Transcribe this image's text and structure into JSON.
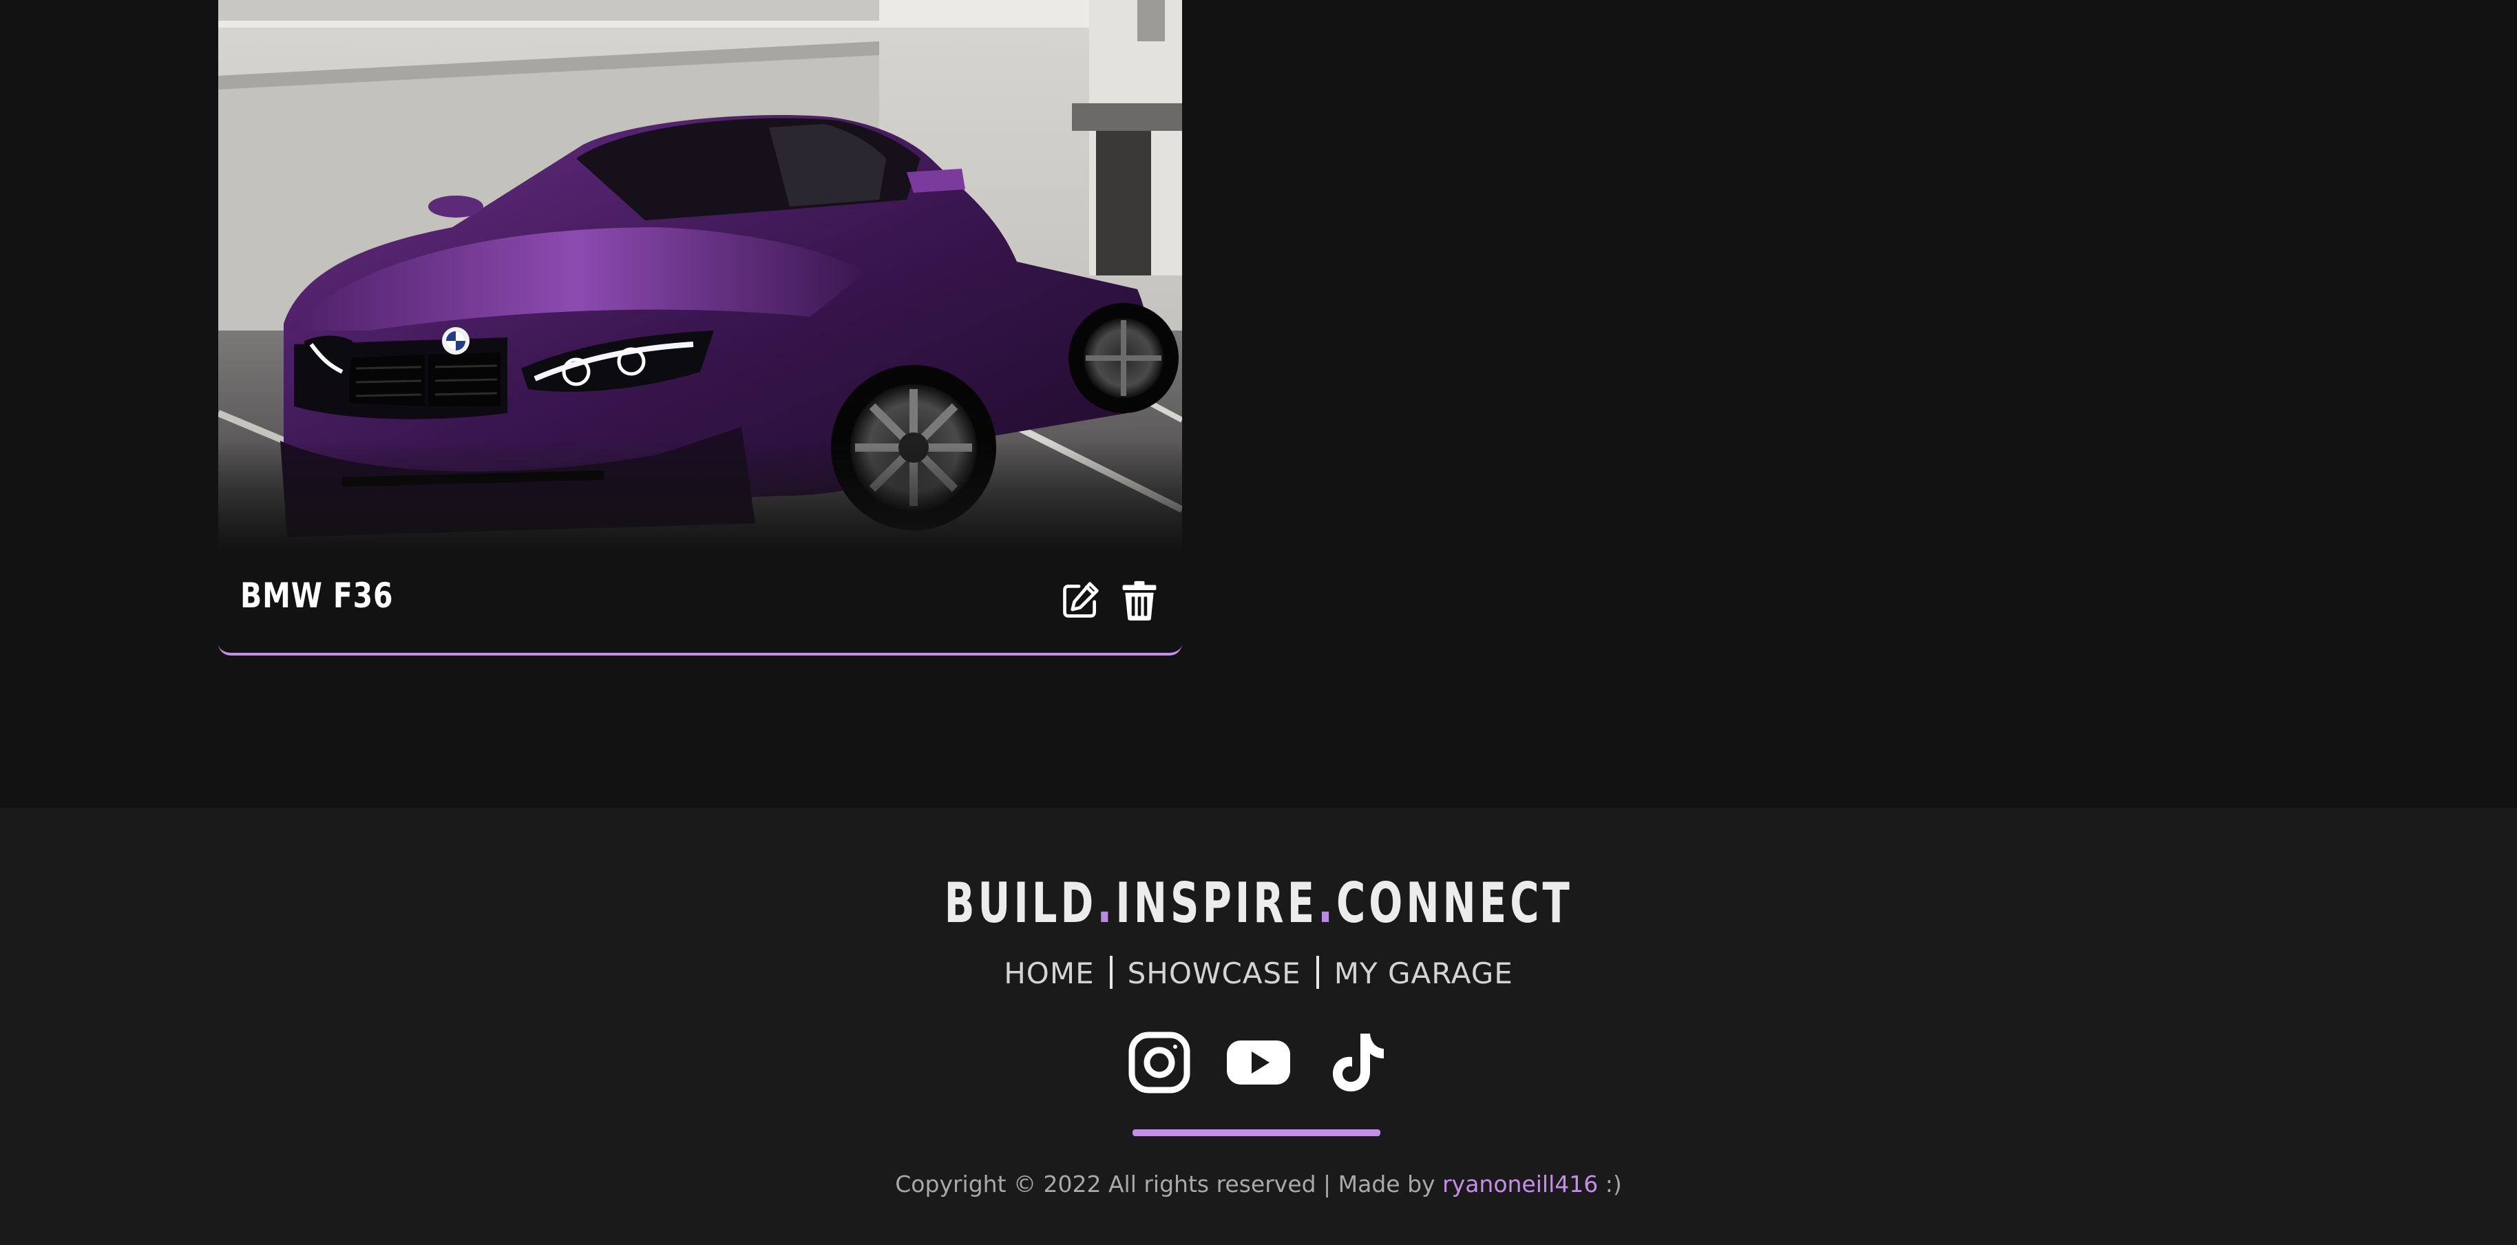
{
  "car_card": {
    "name": "BMW F36",
    "photo_alt": "",
    "edit_icon": "edit-icon",
    "delete_icon": "trash-icon",
    "accent_color": "#c58ee9"
  },
  "footer": {
    "tagline": {
      "words": [
        "BUILD",
        "INSPIRE",
        "CONNECT"
      ],
      "separator": "."
    },
    "nav": [
      {
        "label": "HOME"
      },
      {
        "label": "SHOWCASE"
      },
      {
        "label": "MY GARAGE"
      }
    ],
    "socials": [
      {
        "icon": "instagram-icon"
      },
      {
        "icon": "youtube-icon"
      },
      {
        "icon": "tiktok-icon"
      }
    ],
    "copyright_prefix": "Copyright © 2022 All rights reserved | Made by",
    "author": "ryanoneill416",
    "copyright_suffix": ":)",
    "accent_color": "#c58ee9"
  }
}
